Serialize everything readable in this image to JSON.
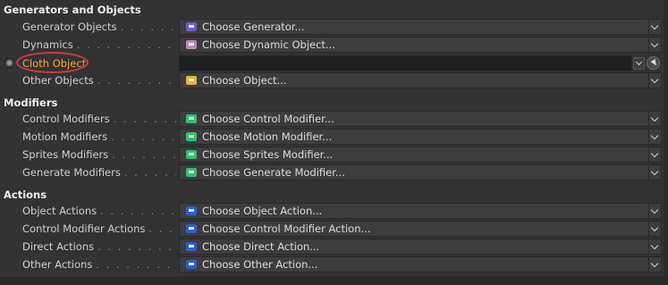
{
  "sections": {
    "generators": {
      "title": "Generators and Objects",
      "rows": [
        {
          "label": "Generator Objects",
          "value": "Choose Generator...",
          "icon": "generator-icon",
          "color": "#6a5acd"
        },
        {
          "label": "Dynamics",
          "value": "Choose Dynamic Object...",
          "icon": "dynamic-object-icon",
          "color": "#b98ab8"
        },
        {
          "label": "Cloth Object",
          "value": "",
          "icon": "",
          "color": "#f2a53a"
        },
        {
          "label": "Other Objects",
          "value": "Choose Object...",
          "icon": "object-icon",
          "color": "#e0b83a"
        }
      ]
    },
    "modifiers": {
      "title": "Modifiers",
      "rows": [
        {
          "label": "Control Modifiers",
          "value": "Choose Control Modifier...",
          "icon": "control-modifier-icon",
          "color": "#2fbf71"
        },
        {
          "label": "Motion Modifiers",
          "value": "Choose Motion Modifier...",
          "icon": "motion-modifier-icon",
          "color": "#2fbf71"
        },
        {
          "label": "Sprites Modifiers",
          "value": "Choose Sprites Modifier...",
          "icon": "sprites-modifier-icon",
          "color": "#2fbf71"
        },
        {
          "label": "Generate Modifiers",
          "value": "Choose Generate Modifier...",
          "icon": "generate-modifier-icon",
          "color": "#2fbf71"
        }
      ]
    },
    "actions": {
      "title": "Actions",
      "rows": [
        {
          "label": "Object Actions",
          "value": "Choose Object Action...",
          "icon": "object-action-icon",
          "color": "#2a5fd6"
        },
        {
          "label": "Control Modifier Actions",
          "value": "Choose Control Modifier Action...",
          "icon": "control-modifier-action-icon",
          "color": "#2a5fd6"
        },
        {
          "label": "Direct Actions",
          "value": "Choose Direct Action...",
          "icon": "direct-action-icon",
          "color": "#2a5fd6"
        },
        {
          "label": "Other Actions",
          "value": "Choose Other Action...",
          "icon": "other-action-icon",
          "color": "#2a5fd6"
        }
      ]
    }
  },
  "dots": ". . . . . . . . . . . . . . . . . . . ."
}
